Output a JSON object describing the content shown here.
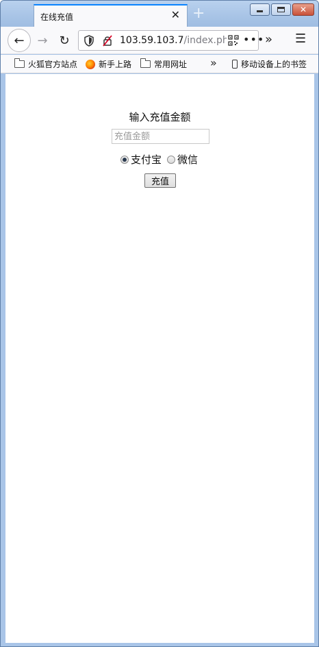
{
  "tab": {
    "title": "在线充值",
    "close_glyph": "✕",
    "new_tab_glyph": "+"
  },
  "window_controls": {
    "minimize": "minimize-icon",
    "maximize": "maximize-icon",
    "close": "close-icon"
  },
  "nav": {
    "back_glyph": "←",
    "forward_glyph": "→",
    "reload_glyph": "↻",
    "url_host": "103.59.103.7",
    "url_path": "/index.php",
    "more_glyph": "•••",
    "overflow_glyph": "»",
    "menu_glyph": "☰"
  },
  "bookmarks": {
    "items": [
      {
        "label": "火狐官方站点",
        "icon": "folder-icon"
      },
      {
        "label": "新手上路",
        "icon": "firefox-icon"
      },
      {
        "label": "常用网址",
        "icon": "folder-icon"
      }
    ],
    "overflow_glyph": "»",
    "mobile": {
      "label": "移动设备上的书签",
      "icon": "phone-icon"
    }
  },
  "form": {
    "title": "输入充值金额",
    "amount_placeholder": "充值金额",
    "payment_options": [
      {
        "label": "支付宝",
        "checked": true
      },
      {
        "label": "微信",
        "checked": false
      }
    ],
    "submit_label": "充值"
  },
  "colors": {
    "accent": "#0a84ff",
    "frame": "#a9c5e8"
  }
}
